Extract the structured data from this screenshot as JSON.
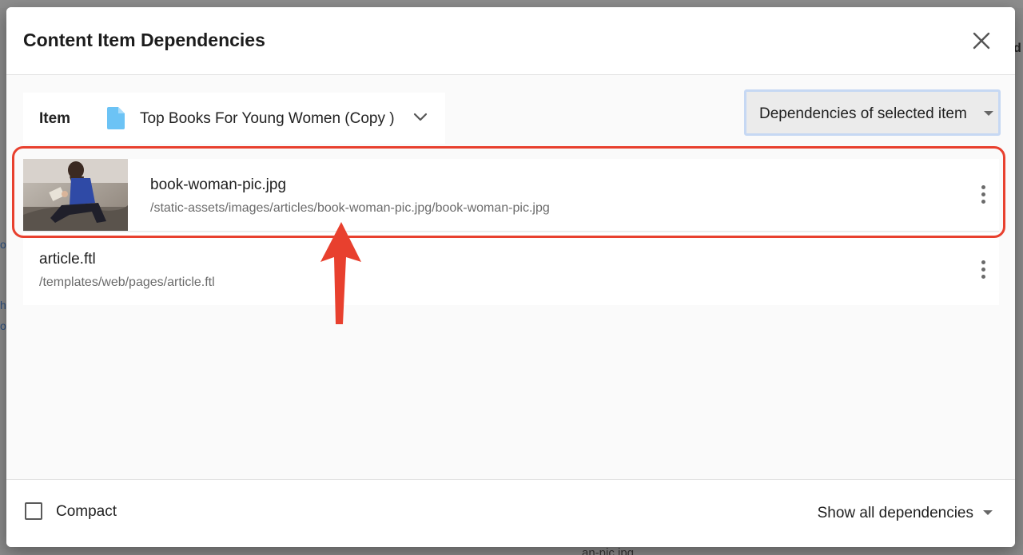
{
  "dialog": {
    "title": "Content Item Dependencies",
    "close_icon": "close-icon"
  },
  "item_selector": {
    "label": "Item",
    "value": "Top Books For Young Women (Copy )",
    "icon": "file-icon",
    "chevron_icon": "chevron-down-icon"
  },
  "dependency_type": {
    "selected": "Dependencies of selected item",
    "caret_icon": "caret-down-icon"
  },
  "dependencies": [
    {
      "name": "book-woman-pic.jpg",
      "path": "/static-assets/images/articles/book-woman-pic.jpg/book-woman-pic.jpg",
      "thumbnail": "image-thumbnail",
      "highlighted": true
    },
    {
      "name": "article.ftl",
      "path": "/templates/web/pages/article.ftl",
      "highlighted": false
    }
  ],
  "footer": {
    "compact_label": "Compact",
    "compact_checked": false,
    "show_label": "Show all dependencies"
  },
  "annotation": {
    "highlight_color": "#e8402e"
  },
  "background": {
    "fragment_right": "d",
    "fragment_bottom": "an-pic.jpg",
    "fragment_left_1": "o",
    "fragment_left_2": "h",
    "fragment_left_3": "o"
  },
  "colors": {
    "file_icon": "#6cc3f5",
    "select_border": "#c6d8f3"
  }
}
